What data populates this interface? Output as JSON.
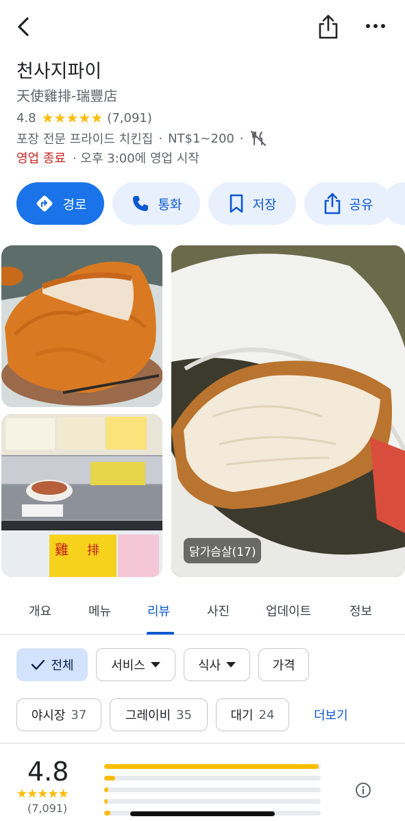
{
  "header": {
    "back_icon": "chevron-left-icon",
    "share_icon": "share-icon",
    "more_icon": "more-horiz-icon"
  },
  "place": {
    "name": "천사지파이",
    "subtitle": "天使雞排-瑞豐店",
    "rating": "4.8",
    "stars": "★★★★★",
    "review_count": "(7,091)",
    "category": "포장 전문 프라이드 치킨집",
    "price": "NT$1~200",
    "dot": "·",
    "dot2": "·",
    "no_dine_in_icon": "no-dine-in-icon",
    "status_closed": "영업 종료",
    "status_rest": "· 오후 3:00에 영업 시작"
  },
  "actions": {
    "directions": "경로",
    "call": "통화",
    "save": "저장",
    "share": "공유"
  },
  "photos": {
    "caption": "닭가슴살(17)"
  },
  "tabs": [
    "개요",
    "메뉴",
    "리뷰",
    "사진",
    "업데이트",
    "정보"
  ],
  "filters": {
    "all": "전체",
    "service": "서비스",
    "meal": "식사",
    "price": "가격"
  },
  "topics": [
    {
      "label": "야시장",
      "count": "37"
    },
    {
      "label": "그레이비",
      "count": "35"
    },
    {
      "label": "대기",
      "count": "24"
    }
  ],
  "more_label": "더보기",
  "summary": {
    "score": "4.8",
    "stars": "★★★★★",
    "count": "(7,091)",
    "distribution": [
      0.99,
      0.05,
      0.02,
      0.01,
      0.03
    ]
  },
  "colors": {
    "accent": "#1a73e8",
    "star": "#fbbc04",
    "closed": "#c5221f"
  }
}
